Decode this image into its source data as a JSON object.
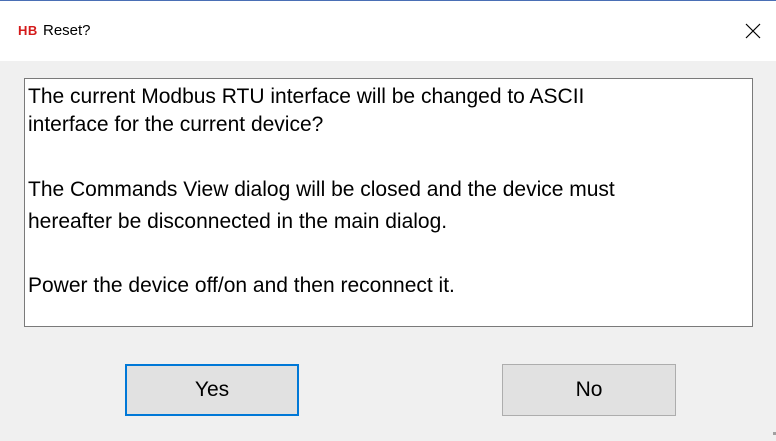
{
  "window": {
    "app_icon_text": "HB",
    "title": "Reset?",
    "close_icon": "close-icon"
  },
  "message": {
    "line1": "The current Modbus RTU interface will be changed to ASCII",
    "line2": "interface for the current device?",
    "line3": "The Commands View dialog will be closed and the device must",
    "line4": "hereafter be disconnected in the main dialog.",
    "line5": " Power the device off/on and then reconnect it."
  },
  "buttons": {
    "yes_label": "Yes",
    "no_label": "No"
  },
  "colors": {
    "app_icon": "#d41a1a",
    "focus_border": "#0078d7",
    "button_face": "#e1e1e1",
    "dialog_background": "#f0f0f0"
  }
}
